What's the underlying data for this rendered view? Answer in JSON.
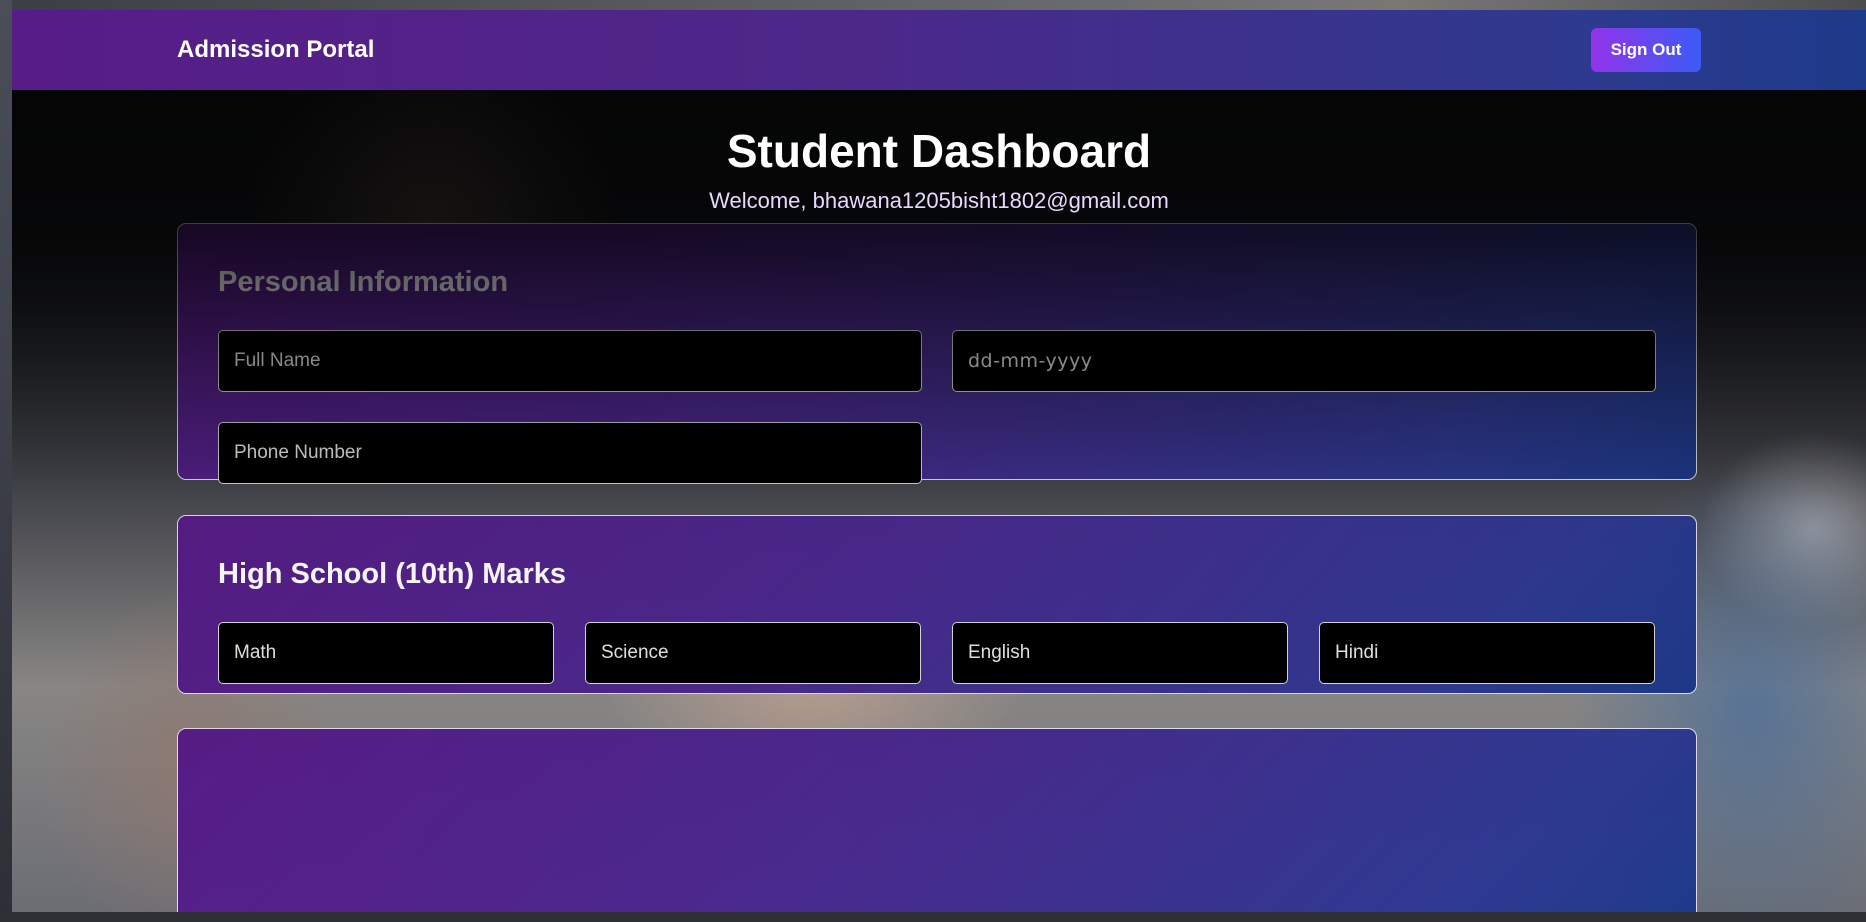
{
  "header": {
    "brand": "Admission Portal",
    "sign_out_label": "Sign Out"
  },
  "dashboard": {
    "title": "Student Dashboard",
    "welcome": "Welcome, bhawana1205bisht1802@gmail.com"
  },
  "personal_info": {
    "heading": "Personal Information",
    "full_name_placeholder": "Full Name",
    "dob_placeholder": "dd-mm-yyyy",
    "phone_placeholder": "Phone Number"
  },
  "high_school": {
    "heading": "High School (10th) Marks",
    "subjects": [
      "Math",
      "Science",
      "English",
      "Hindi"
    ]
  },
  "colors": {
    "purple": "#581c87",
    "blue": "#1e3a8a",
    "button_start": "#9333ea",
    "button_end": "#3b5bf6"
  }
}
